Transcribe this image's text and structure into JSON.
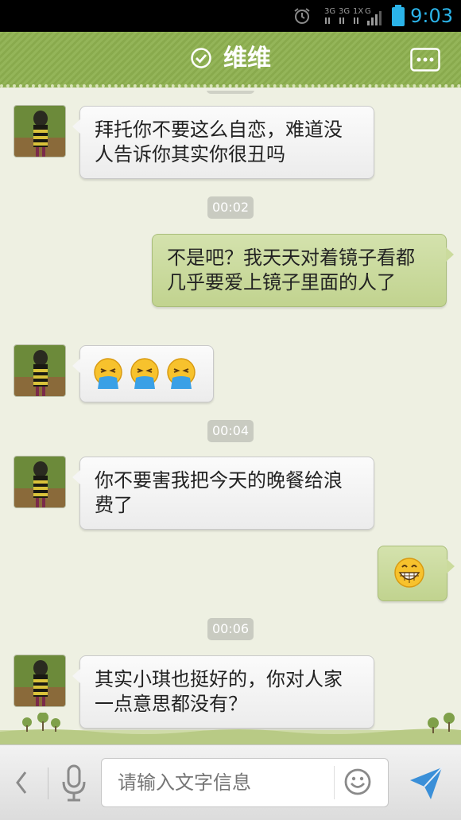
{
  "status_bar": {
    "network_labels": [
      "3G",
      "3G",
      "1X",
      "G"
    ],
    "time": "9:03"
  },
  "header": {
    "title": "维维"
  },
  "messages": [
    {
      "side": "left",
      "text": "拜托你不要这么自恋，难道没人告诉你其实你很丑吗"
    },
    {
      "timestamp": "00:02"
    },
    {
      "side": "right",
      "text": "不是吧？我天天对着镜子看都几乎要爱上镜子里面的人了"
    },
    {
      "side": "left",
      "emoji": [
        "vomit-emoji",
        "vomit-emoji",
        "vomit-emoji"
      ]
    },
    {
      "timestamp": "00:04"
    },
    {
      "side": "left",
      "text": "你不要害我把今天的晚餐给浪费了"
    },
    {
      "side": "right",
      "emoji": [
        "grin-emoji"
      ]
    },
    {
      "timestamp": "00:06"
    },
    {
      "side": "left",
      "text": "其实小琪也挺好的，你对人家一点意思都没有？"
    }
  ],
  "input_bar": {
    "placeholder": "请输入文字信息"
  },
  "colors": {
    "header_green": "#8db04f",
    "right_bubble": "#c9d99a",
    "left_bubble": "#f4f4f4",
    "background": "#eef0e2",
    "status_blue": "#2bb3e8"
  }
}
